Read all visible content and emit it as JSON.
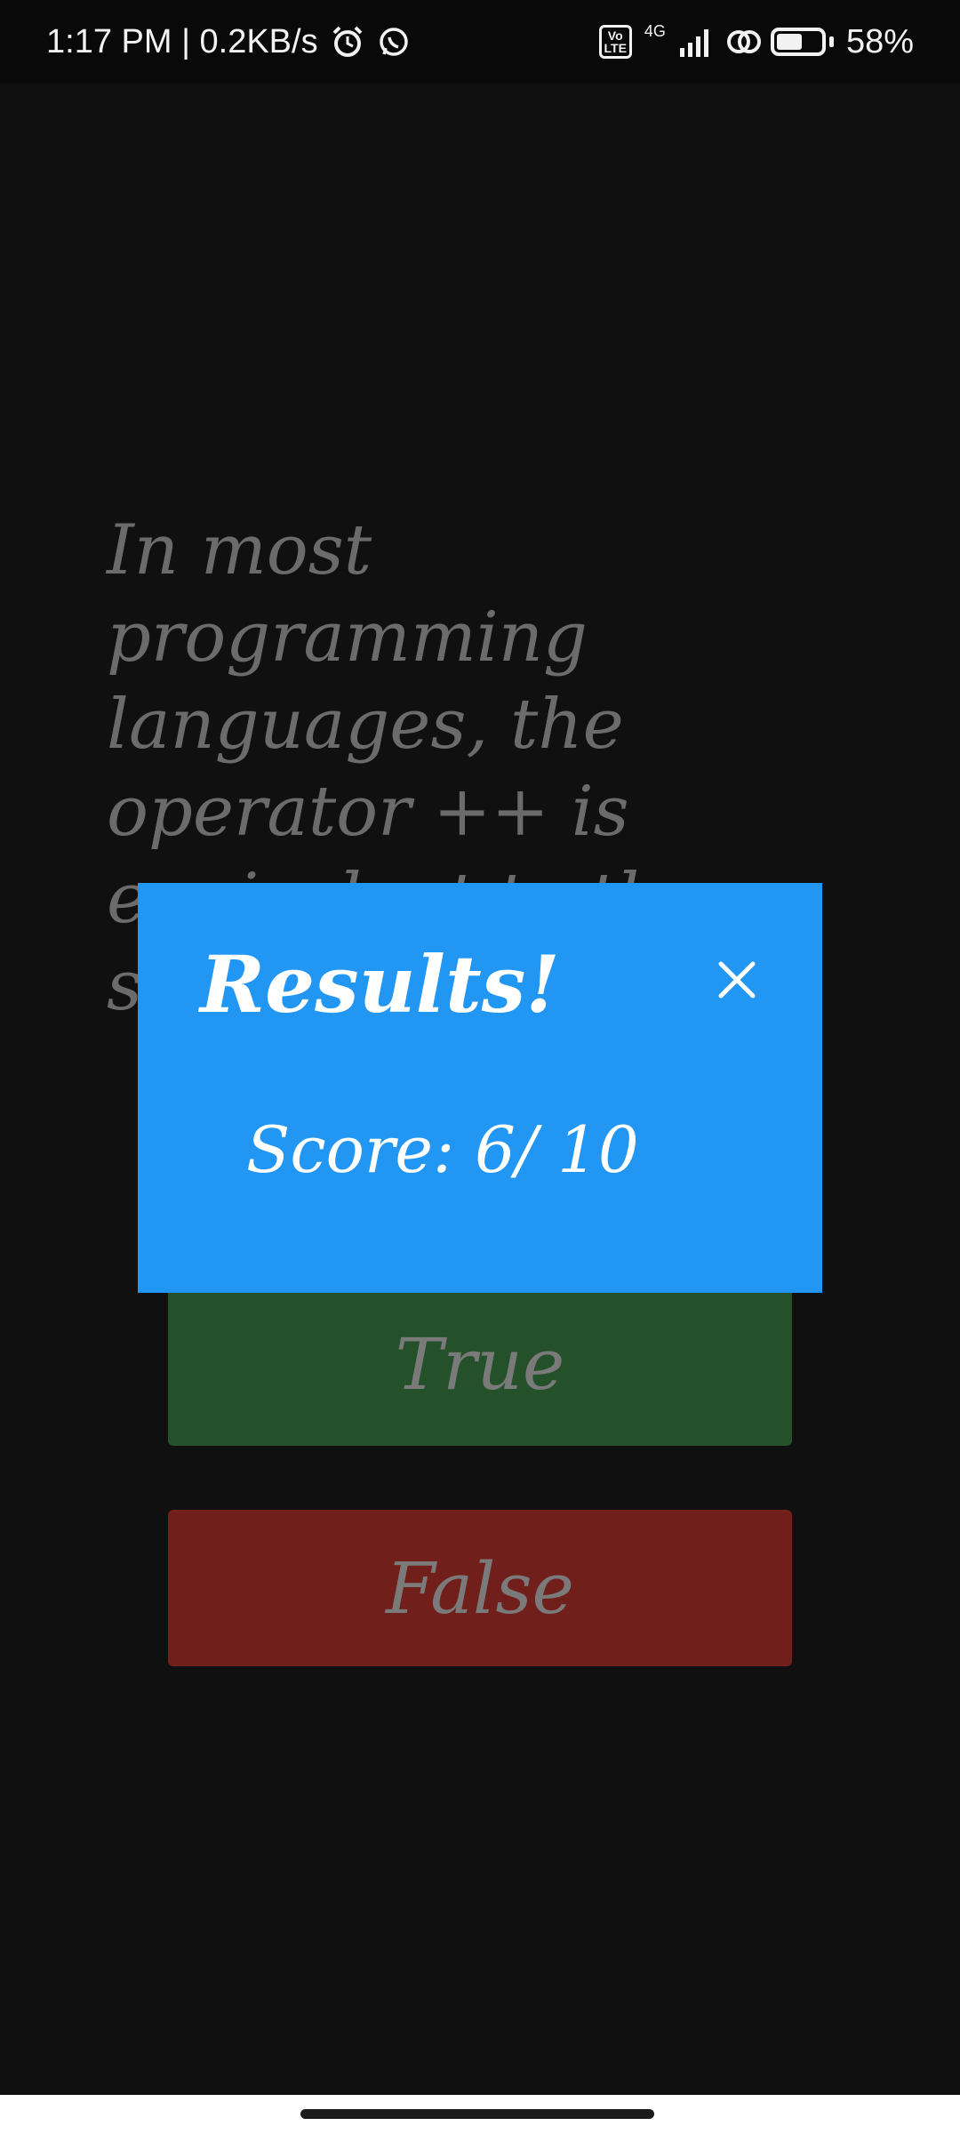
{
  "status_bar": {
    "time_speed": "1:17 PM | 0.2KB/s",
    "volte": "Vo\nLTE",
    "network": "4G",
    "battery": "58%",
    "battery_level": 0.58
  },
  "question": {
    "text": "In most programming languages, the operator ++ is equivalent to the statement \"+= 1\"."
  },
  "answers": {
    "true_label": "True",
    "false_label": "False",
    "true_color": "#24502a",
    "false_color": "#711f1b"
  },
  "modal": {
    "title": "Results!",
    "score": "Score: 6/ 10",
    "close_icon": "close-icon",
    "color": "#2196f3"
  }
}
